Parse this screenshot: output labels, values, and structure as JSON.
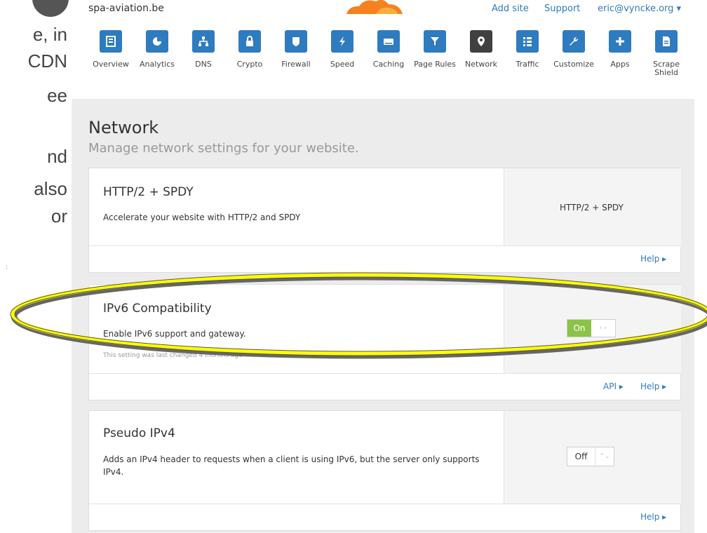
{
  "slide": {
    "lines": [
      "e, in",
      "CDN",
      "ee",
      "",
      "nd",
      "also",
      "or"
    ]
  },
  "header": {
    "site": "spa-aviation.be",
    "add_site": "Add site",
    "support": "Support",
    "user": "eric@vyncke.org",
    "user_caret": "▾"
  },
  "nav": [
    {
      "label": "Overview",
      "icon": "overview-icon"
    },
    {
      "label": "Analytics",
      "icon": "pie-chart-icon"
    },
    {
      "label": "DNS",
      "icon": "network-tree-icon"
    },
    {
      "label": "Crypto",
      "icon": "lock-icon"
    },
    {
      "label": "Firewall",
      "icon": "shield-icon"
    },
    {
      "label": "Speed",
      "icon": "lightning-icon"
    },
    {
      "label": "Caching",
      "icon": "drive-icon"
    },
    {
      "label": "Page Rules",
      "icon": "filter-icon"
    },
    {
      "label": "Network",
      "icon": "location-pin-icon",
      "active": true
    },
    {
      "label": "Traffic",
      "icon": "list-icon"
    },
    {
      "label": "Customize",
      "icon": "wrench-icon"
    },
    {
      "label": "Apps",
      "icon": "plus-icon"
    },
    {
      "label": "Scrape Shield",
      "icon": "document-icon"
    }
  ],
  "page": {
    "title": "Network",
    "subtitle": "Manage network settings for your website."
  },
  "cards": {
    "http2": {
      "title": "HTTP/2 + SPDY",
      "description": "Accelerate your website with HTTP/2 and SPDY",
      "control_text": "HTTP/2 + SPDY",
      "help": "Help ▸"
    },
    "ipv6": {
      "title": "IPv6 Compatibility",
      "description": "Enable IPv6 support and gateway.",
      "meta": "This setting was last changed 4 months ago",
      "toggle_on": "On",
      "toggle_knob": "‹ ›",
      "api": "API ▸",
      "help": "Help ▸"
    },
    "pseudo": {
      "title": "Pseudo IPv4",
      "description": "Adds an IPv4 header to requests when a client is using IPv6, but the server only supports IPv4.",
      "select_value": "Off",
      "select_arrows": "⌃⌄",
      "help": "Help ▸"
    }
  },
  "colors": {
    "brand_blue": "#2f7bbf",
    "active_tile": "#404040",
    "toggle_green": "#8bc34a",
    "highlight_yellow": "#ffff00"
  }
}
